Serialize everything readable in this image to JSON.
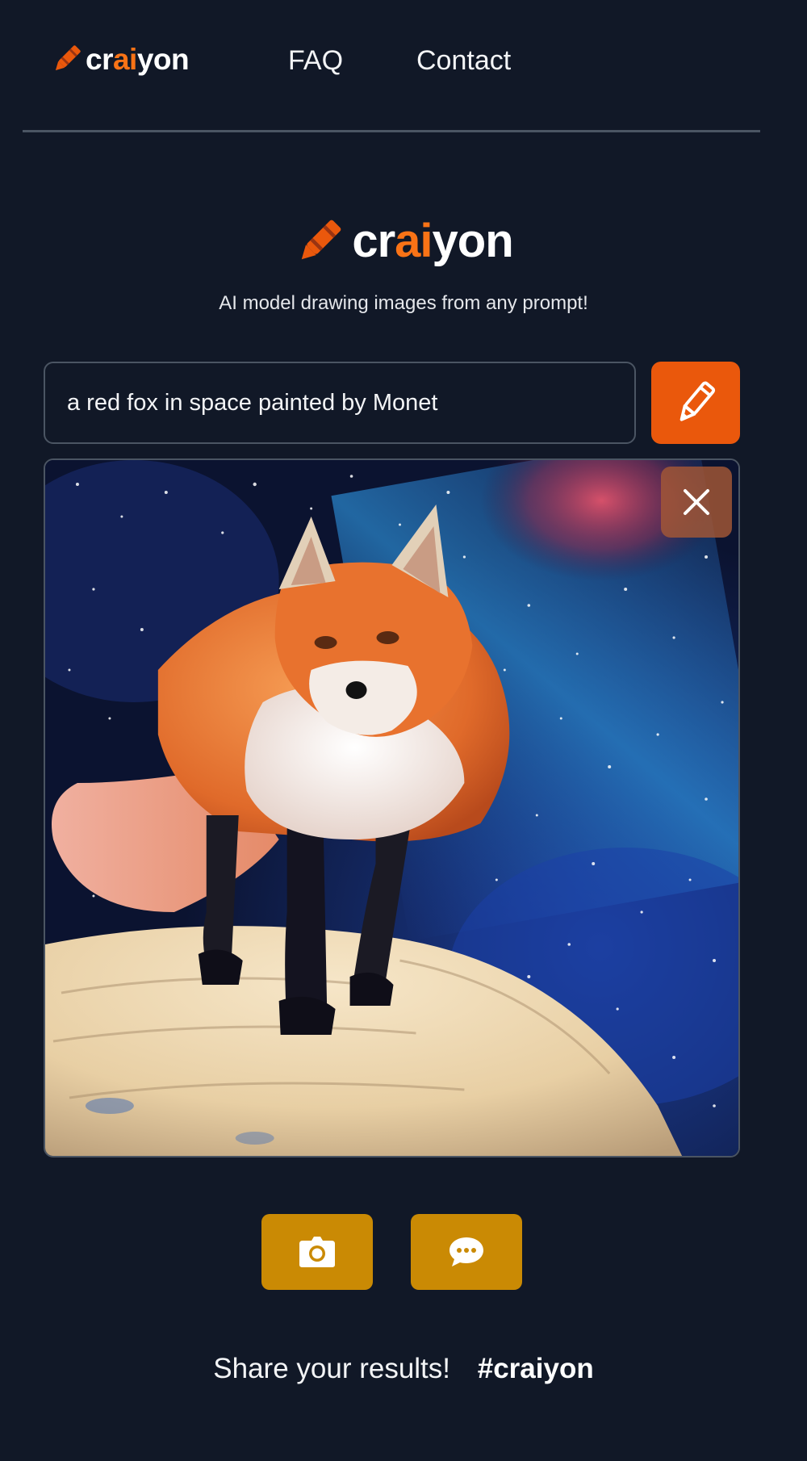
{
  "nav": {
    "logo": {
      "part1": "cr",
      "part2": "ai",
      "part3": "yon"
    },
    "links": [
      {
        "label": "FAQ"
      },
      {
        "label": "Contact"
      }
    ]
  },
  "hero": {
    "logo": {
      "part1": "cr",
      "part2": "ai",
      "part3": "yon"
    },
    "tagline": "AI model drawing images from any prompt!"
  },
  "prompt": {
    "value": "a red fox in space painted by Monet",
    "draw_icon": "pencil-icon"
  },
  "result": {
    "image_subject": "red fox standing in space, Monet painting style",
    "close_icon": "close-icon"
  },
  "actions": [
    {
      "icon": "camera-icon"
    },
    {
      "icon": "chat-bubble-icon"
    }
  ],
  "share": {
    "text": "Share your results!",
    "hashtag": "#craiyon"
  },
  "colors": {
    "background": "#111827",
    "brand_orange": "#ea580c",
    "accent_text": "#f97316",
    "action_gold": "#ca8a04",
    "divider": "#4b5563"
  }
}
